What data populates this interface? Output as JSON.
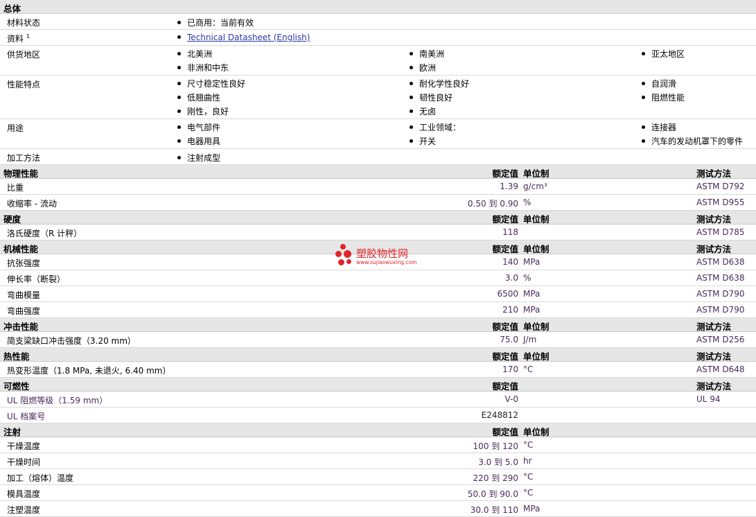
{
  "general": {
    "title": "总体",
    "material_status": {
      "label": "材料状态",
      "value": "已商用：当前有效"
    },
    "docs": {
      "label": "资料",
      "sup": "1",
      "link": "Technical Datasheet (English)"
    },
    "availability": {
      "label": "供货地区",
      "items": [
        "北美洲",
        "南美洲",
        "亚太地区",
        "非洲和中东",
        "欧洲"
      ]
    },
    "features": {
      "label": "性能特点",
      "items": [
        "尺寸稳定性良好",
        "耐化学性良好",
        "自润滑",
        "低翘曲性",
        "韧性良好",
        "阻燃性能",
        "刚性，良好",
        "无卤"
      ]
    },
    "uses": {
      "label": "用途",
      "items": [
        "电气部件",
        "工业领域：",
        "连接器",
        "电器用具",
        "开关",
        "汽车的发动机罩下的零件"
      ]
    },
    "processing": {
      "label": "加工方法",
      "value": "注射成型"
    }
  },
  "col_headers": {
    "nominal": "额定值",
    "unit": "单位制",
    "method": "测试方法"
  },
  "physical": {
    "title": "物理性能",
    "rows": [
      {
        "name": "比重",
        "value": "1.39",
        "unit": "g/cm³",
        "method": "ASTM D792"
      },
      {
        "name": "收缩率 - 流动",
        "value": "0.50 到  0.90",
        "unit": "%",
        "method": "ASTM D955"
      }
    ]
  },
  "hardness": {
    "title": "硬度",
    "rows": [
      {
        "name": "洛氏硬度（R 计秤）",
        "value": "118",
        "unit": "",
        "method": "ASTM D785"
      }
    ]
  },
  "mechanical": {
    "title": "机械性能",
    "rows": [
      {
        "name": "抗张强度",
        "value": "140",
        "unit": "MPa",
        "method": "ASTM D638"
      },
      {
        "name": "伸长率（断裂）",
        "value": "3.0",
        "unit": "%",
        "method": "ASTM D638"
      },
      {
        "name": "弯曲模量",
        "value": "6500",
        "unit": "MPa",
        "method": "ASTM D790"
      },
      {
        "name": "弯曲强度",
        "value": "210",
        "unit": "MPa",
        "method": "ASTM D790"
      }
    ]
  },
  "impact": {
    "title": "冲击性能",
    "rows": [
      {
        "name": "简支梁缺口冲击强度（3.20 mm）",
        "value": "75.0",
        "unit": "J/m",
        "method": "ASTM D256"
      }
    ]
  },
  "thermal": {
    "title": "热性能",
    "rows": [
      {
        "name": "热变形温度（1.8 MPa, 未退火, 6.40 mm）",
        "value": "170",
        "unit": "°C",
        "method": "ASTM D648"
      }
    ]
  },
  "flammability": {
    "title": "可燃性",
    "rows": [
      {
        "name": "UL 阻燃等级（1.59 mm）",
        "value": "V-0",
        "unit": "",
        "method": "UL 94"
      },
      {
        "name": "UL 档案号",
        "value": "E248812",
        "unit": "",
        "method": ""
      }
    ]
  },
  "injection": {
    "title": "注射",
    "rows": [
      {
        "name": "干燥温度",
        "value": "100 到  120",
        "unit": "°C",
        "method": ""
      },
      {
        "name": "干燥时间",
        "value": "3.0 到  5.0",
        "unit": "hr",
        "method": ""
      },
      {
        "name": "加工（熔体）温度",
        "value": "220 到  290",
        "unit": "°C",
        "method": ""
      },
      {
        "name": "模具温度",
        "value": "50.0 到  90.0",
        "unit": "°C",
        "method": ""
      },
      {
        "name": "注塑温度",
        "value": "30.0 到  110",
        "unit": "MPa",
        "method": ""
      }
    ]
  },
  "watermark": {
    "title": "塑胶物性网",
    "url": "www.sujiaowuxing.com"
  }
}
